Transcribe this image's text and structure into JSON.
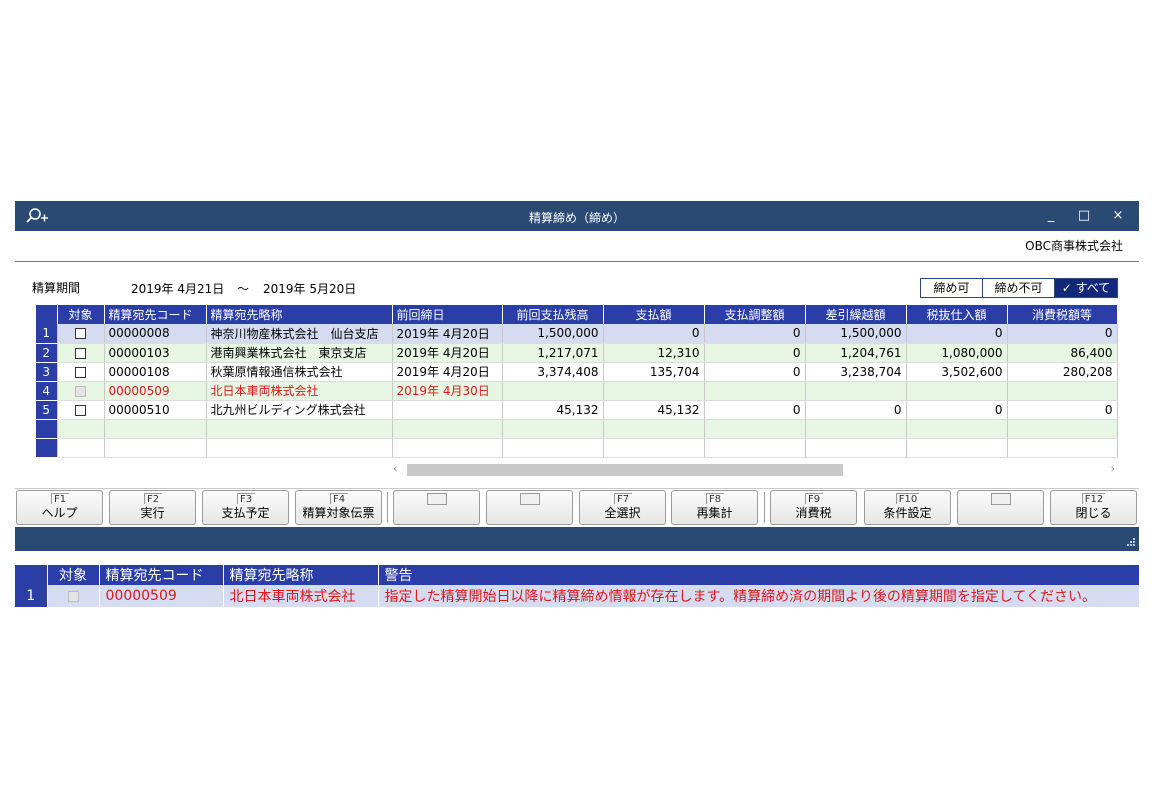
{
  "window": {
    "title": "精算締め（締め）",
    "app_icon": "search-plus-icon",
    "minimize": "_",
    "maximize": "□",
    "close": "×",
    "company": "OBC商事株式会社"
  },
  "period": {
    "label": "精算期間",
    "from": "2019年 4月21日",
    "tilde": "～",
    "to": "2019年 5月20日"
  },
  "filter": {
    "options": [
      "締め可",
      "締め不可",
      "✓ すべて"
    ],
    "selected": "すべて"
  },
  "grid": {
    "headers": [
      "",
      "対象",
      "精算宛先コード",
      "精算宛先略称",
      "前回締日",
      "前回支払残高",
      "支払額",
      "支払調整額",
      "差引繰越額",
      "税抜仕入額",
      "消費税額等"
    ],
    "rows": [
      {
        "no": "1",
        "code": "00000008",
        "name": "神奈川物産株式会社　仙台支店",
        "prev_close": "2019年 4月20日",
        "prev_balance": "1,500,000",
        "payment": "0",
        "adjust": "0",
        "carryover": "1,500,000",
        "purchase": "0",
        "tax": "0"
      },
      {
        "no": "2",
        "code": "00000103",
        "name": "港南興業株式会社　東京支店",
        "prev_close": "2019年 4月20日",
        "prev_balance": "1,217,071",
        "payment": "12,310",
        "adjust": "0",
        "carryover": "1,204,761",
        "purchase": "1,080,000",
        "tax": "86,400"
      },
      {
        "no": "3",
        "code": "00000108",
        "name": "秋葉原情報通信株式会社",
        "prev_close": "2019年 4月20日",
        "prev_balance": "3,374,408",
        "payment": "135,704",
        "adjust": "0",
        "carryover": "3,238,704",
        "purchase": "3,502,600",
        "tax": "280,208"
      },
      {
        "no": "4",
        "code": "00000509",
        "name": "北日本車両株式会社",
        "prev_close": "2019年 4月30日",
        "prev_balance": "",
        "payment": "",
        "adjust": "",
        "carryover": "",
        "purchase": "",
        "tax": ""
      },
      {
        "no": "5",
        "code": "00000510",
        "name": "北九州ビルディング株式会社",
        "prev_close": "",
        "prev_balance": "45,132",
        "payment": "45,132",
        "adjust": "0",
        "carryover": "0",
        "purchase": "0",
        "tax": "0"
      }
    ]
  },
  "scroll": {
    "left": "‹",
    "right": "›"
  },
  "fkeys": [
    {
      "key": "F1",
      "label": "ヘルプ"
    },
    {
      "key": "F2",
      "label": "実行"
    },
    {
      "key": "F3",
      "label": "支払予定"
    },
    {
      "key": "F4",
      "label": "精算対象伝票"
    },
    {
      "key": "",
      "label": ""
    },
    {
      "key": "",
      "label": ""
    },
    {
      "key": "F7",
      "label": "全選択"
    },
    {
      "key": "F8",
      "label": "再集計"
    },
    {
      "key": "F9",
      "label": "消費税"
    },
    {
      "key": "F10",
      "label": "条件設定"
    },
    {
      "key": "",
      "label": ""
    },
    {
      "key": "F12",
      "label": "閉じる"
    }
  ],
  "warnings": {
    "headers": [
      "",
      "対象",
      "精算宛先コード",
      "精算宛先略称",
      "警告"
    ],
    "rows": [
      {
        "no": "1",
        "code": "00000509",
        "name": "北日本車両株式会社",
        "message": "指定した精算開始日以降に精算締め情報が存在します。精算締め済の期間より後の精算期間を指定してください。"
      }
    ]
  },
  "colors": {
    "titlebar": "#2a4a74",
    "grid_header": "#2b3ea8",
    "row_blue": "#d5dcf2",
    "row_green": "#e6f6e3",
    "error_text": "#e01818"
  }
}
